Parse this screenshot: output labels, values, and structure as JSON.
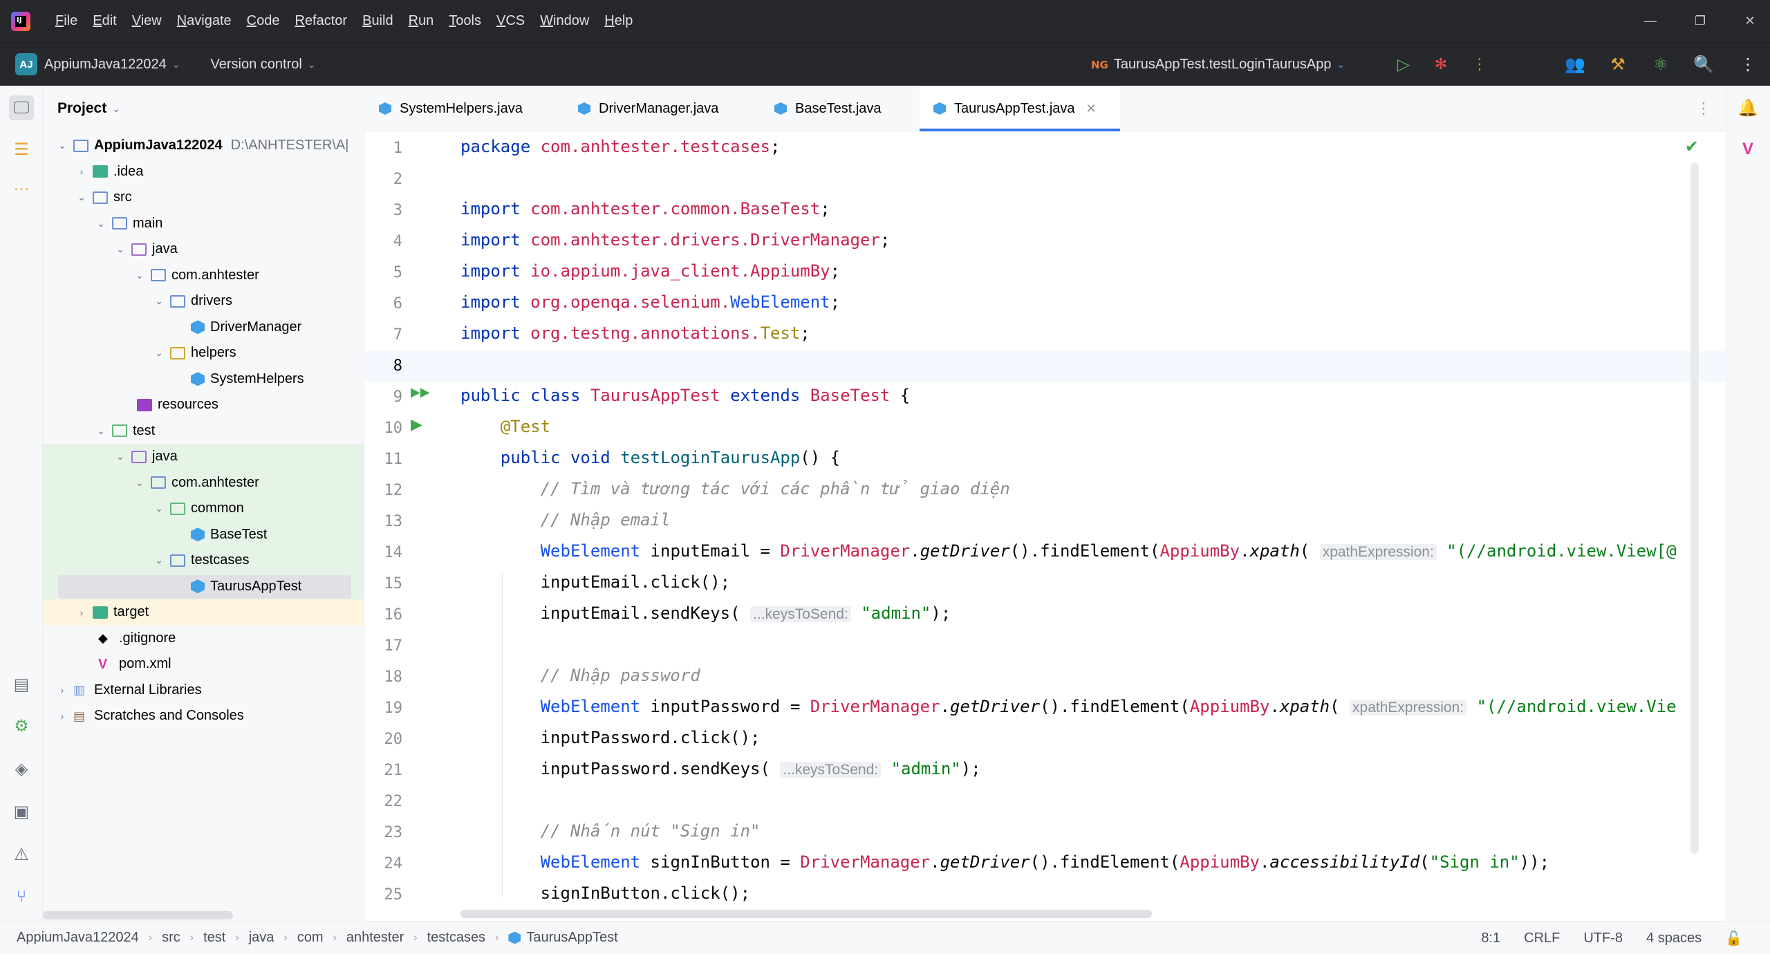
{
  "menu": [
    "File",
    "Edit",
    "View",
    "Navigate",
    "Code",
    "Refactor",
    "Build",
    "Run",
    "Tools",
    "VCS",
    "Window",
    "Help"
  ],
  "toolbar": {
    "project_badge": "AJ",
    "project_name": "AppiumJava122024",
    "version_control": "Version control",
    "run_config_prefix": "NG",
    "run_config": "TaurusAppTest.testLoginTaurusApp"
  },
  "project_panel": {
    "title": "Project",
    "root_name": "AppiumJava122024",
    "root_path": "D:\\ANHTESTER\\A|",
    "items": [
      ".idea",
      "src",
      "main",
      "java",
      "com.anhtester",
      "drivers",
      "DriverManager",
      "helpers",
      "SystemHelpers",
      "resources",
      "test",
      "java",
      "com.anhtester",
      "common",
      "BaseTest",
      "testcases",
      "TaurusAppTest",
      "target",
      ".gitignore",
      "pom.xml",
      "External Libraries",
      "Scratches and Consoles"
    ]
  },
  "tabs": [
    "SystemHelpers.java",
    "DriverManager.java",
    "BaseTest.java",
    "TaurusAppTest.java"
  ],
  "editor": {
    "line_numbers": [
      "1",
      "2",
      "3",
      "4",
      "5",
      "6",
      "7",
      "8",
      "9",
      "10",
      "11",
      "12",
      "13",
      "14",
      "15",
      "16",
      "17",
      "18",
      "19",
      "20",
      "21",
      "22",
      "23",
      "24",
      "25"
    ],
    "hint_xpath": "xpathExpression:",
    "hint_keys": "...keysToSend:",
    "xpath_value_1": "\"(//android.view.View[@",
    "xpath_value_2": "\"(//android.view.Vie",
    "admin": "\"admin\"",
    "comment_1": "// Tìm và tương tác với các phần tử giao diện",
    "comment_2": "// Nhập email",
    "comment_3": "// Nhập password",
    "comment_4": "// Nhấn nút \"Sign in\"",
    "sign_in": "\"Sign in\""
  },
  "statusbar": {
    "breadcrumb": [
      "AppiumJava122024",
      "src",
      "test",
      "java",
      "com",
      "anhtester",
      "testcases",
      "TaurusAppTest"
    ],
    "position": "8:1",
    "line_ending": "CRLF",
    "encoding": "UTF-8",
    "indent": "4 spaces"
  },
  "colors": {
    "accent": "#3574f0",
    "keyword": "#0033b3",
    "class_name": "#c7254e",
    "string": "#067d17",
    "comment": "#8c8c8c"
  }
}
